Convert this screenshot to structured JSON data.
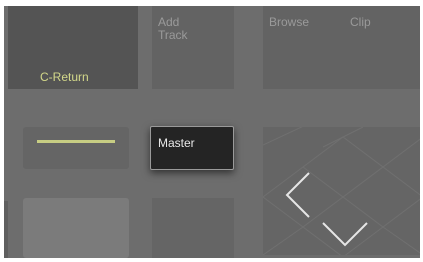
{
  "pads": {
    "c_return_label": "C-Return",
    "add_track_label": "Add\nTrack",
    "browse_label": "Browse",
    "clip_label": "Clip",
    "master_label": "Master"
  },
  "icons": {
    "nav_left": "chevron-left-icon",
    "nav_down": "chevron-down-icon"
  },
  "colors": {
    "background": "#6d6d6d",
    "pad": "#636363",
    "selected_pad": "#545454",
    "accent": "#c7cd83",
    "master_pad": "#242424"
  }
}
